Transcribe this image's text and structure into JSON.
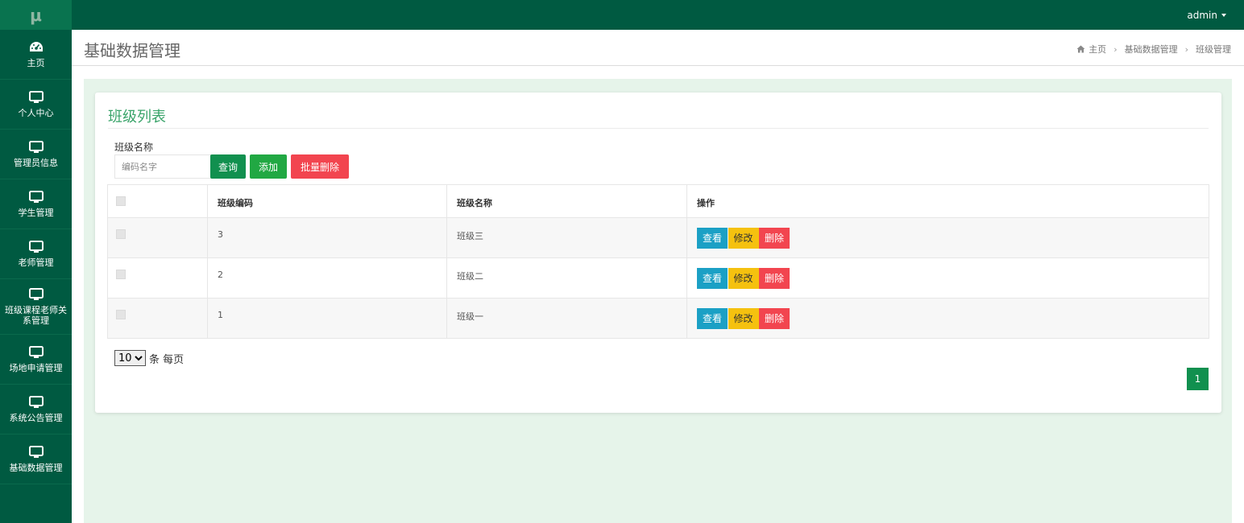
{
  "logo": {
    "text": "μ"
  },
  "user": {
    "name": "admin"
  },
  "sidebar": {
    "items": [
      {
        "label": "主页",
        "icon": "dashboard-icon"
      },
      {
        "label": "个人中心",
        "icon": "monitor-icon"
      },
      {
        "label": "管理员信息",
        "icon": "monitor-icon"
      },
      {
        "label": "学生管理",
        "icon": "monitor-icon"
      },
      {
        "label": "老师管理",
        "icon": "monitor-icon"
      },
      {
        "label": "班级课程老师关系管理",
        "icon": "monitor-icon"
      },
      {
        "label": "场地申请管理",
        "icon": "monitor-icon"
      },
      {
        "label": "系统公告管理",
        "icon": "monitor-icon"
      },
      {
        "label": "基础数据管理",
        "icon": "monitor-icon"
      }
    ]
  },
  "header": {
    "title": "基础数据管理",
    "breadcrumb": [
      "主页",
      "基础数据管理",
      "班级管理"
    ]
  },
  "card": {
    "title": "班级列表",
    "filter": {
      "label": "班级名称",
      "placeholder": "编码名字"
    },
    "buttons": {
      "query": "查询",
      "add": "添加",
      "batch_delete": "批量删除"
    }
  },
  "table": {
    "columns": [
      "",
      "班级编码",
      "班级名称",
      "操作"
    ],
    "rows": [
      {
        "code": "3",
        "name": "班级三"
      },
      {
        "code": "2",
        "name": "班级二"
      },
      {
        "code": "1",
        "name": "班级一"
      }
    ],
    "actions": {
      "view": "查看",
      "edit": "修改",
      "delete": "删除"
    }
  },
  "pagination": {
    "page_size": "10",
    "page_size_options": [
      "10"
    ],
    "page_size_suffix": "条 每页",
    "current_page": "1"
  },
  "colors": {
    "topbar": "#005a41",
    "accent": "#3aa46a",
    "primary_button": "#11904f",
    "danger": "#f2454f",
    "warning": "#f5c10f",
    "info": "#1ba0c5",
    "content_bg": "#e6f4ea"
  }
}
